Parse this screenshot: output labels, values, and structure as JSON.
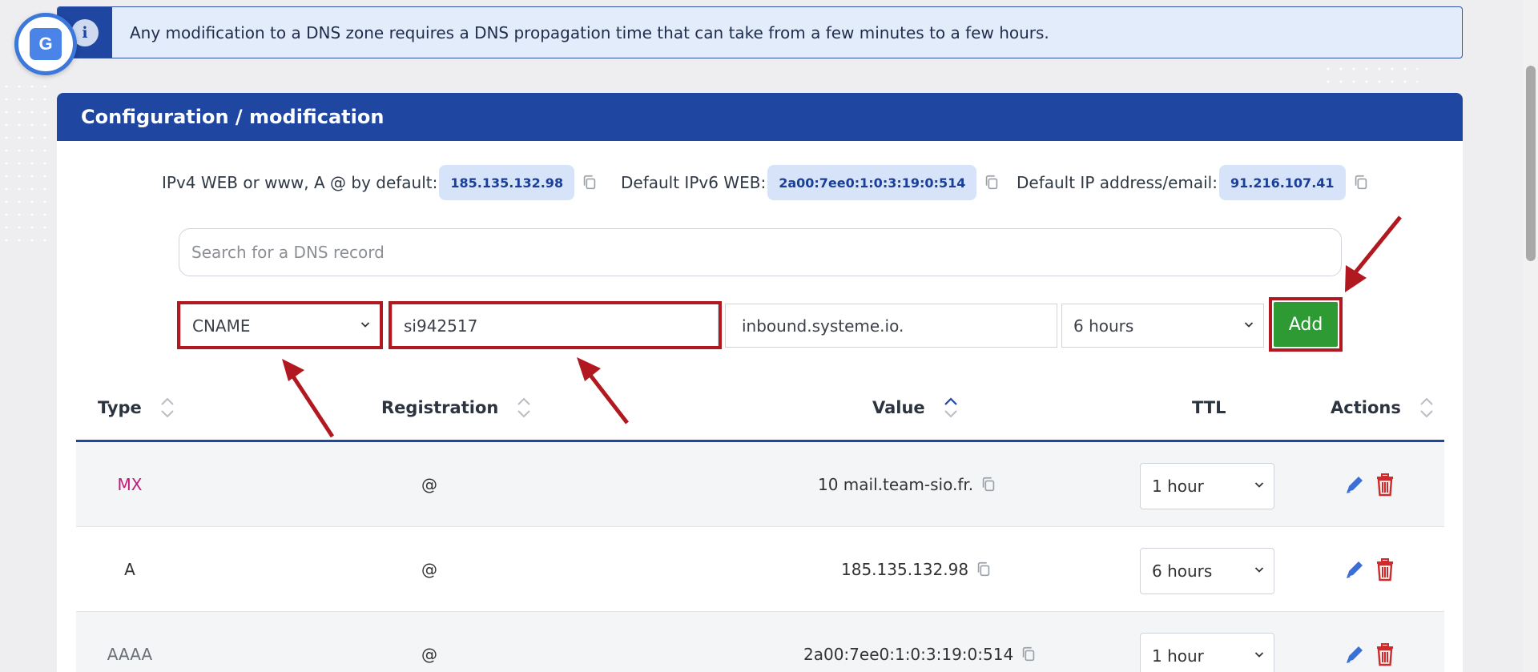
{
  "notice": {
    "text": "Any modification to a DNS zone requires a DNS propagation time that can take from a few minutes to a few hours."
  },
  "card": {
    "title": "Configuration / modification"
  },
  "ips": {
    "ipv4_label": "IPv4 WEB or www, A @ by default:",
    "ipv4_value": "185.135.132.98",
    "ipv6_label": "Default IPv6 WEB:",
    "ipv6_value": "2a00:7ee0:1:0:3:19:0:514",
    "email_label": "Default IP address/email:",
    "email_value": "91.216.107.41"
  },
  "search": {
    "placeholder": "Search for a DNS record"
  },
  "form": {
    "type_value": "CNAME",
    "registration_value": "si942517",
    "value_value": "inbound.systeme.io.",
    "ttl_value": "6 hours",
    "add_label": "Add"
  },
  "table": {
    "headers": {
      "type": "Type",
      "registration": "Registration",
      "value": "Value",
      "ttl": "TTL",
      "actions": "Actions"
    },
    "rows": [
      {
        "type": "MX",
        "registration": "@",
        "value": "10 mail.team-sio.fr.",
        "ttl": "1 hour"
      },
      {
        "type": "A",
        "registration": "@",
        "value": "185.135.132.98",
        "ttl": "6 hours"
      },
      {
        "type": "AAAA",
        "registration": "@",
        "value": "2a00:7ee0:1:0:3:19:0:514",
        "ttl": "1 hour"
      }
    ]
  },
  "colors": {
    "primary": "#1f46a0",
    "add_button": "#2e9a34",
    "highlight_red": "#b1181f",
    "mx_type": "#c2187a"
  },
  "icons": {
    "info": "info-icon",
    "translate": "google-translate-icon",
    "copy": "copy-icon",
    "edit": "pencil-icon",
    "delete": "trash-icon",
    "sort": "sort-icon",
    "dropdown": "chevron-down-icon"
  }
}
